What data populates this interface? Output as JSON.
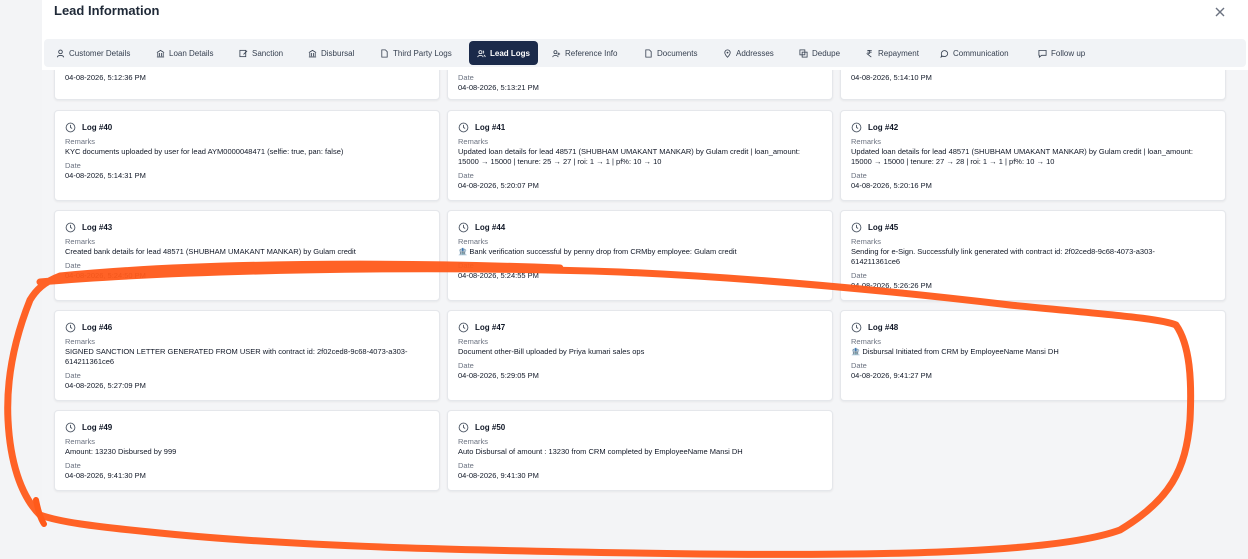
{
  "modal": {
    "title": "Lead Information",
    "close_icon": "close-icon"
  },
  "tabs": [
    {
      "label": "Customer Details",
      "icon": "user-icon"
    },
    {
      "label": "Loan Details",
      "icon": "bank-icon"
    },
    {
      "label": "Sanction",
      "icon": "edit-icon"
    },
    {
      "label": "Disbursal",
      "icon": "bank-icon"
    },
    {
      "label": "Third Party Logs",
      "icon": "file-icon"
    },
    {
      "label": "Lead Logs",
      "icon": "users-icon",
      "active": true
    },
    {
      "label": "Reference Info",
      "icon": "users-icon"
    },
    {
      "label": "Documents",
      "icon": "file-icon"
    },
    {
      "label": "Addresses",
      "icon": "pin-icon"
    },
    {
      "label": "Dedupe",
      "icon": "copy-icon"
    },
    {
      "label": "Repayment",
      "icon": "rupee-icon"
    },
    {
      "label": "Communication",
      "icon": "chat-icon"
    },
    {
      "label": "Follow up",
      "icon": "chat-icon"
    }
  ],
  "partial_top": [
    {
      "date": "04-08-2026, 5:12:36 PM"
    },
    {
      "date_label": "Date",
      "date": "04-08-2026, 5:13:21 PM"
    },
    {
      "date": "04-08-2026, 5:14:10 PM"
    }
  ],
  "labels": {
    "remarks": "Remarks",
    "date": "Date"
  },
  "logs": [
    {
      "title": "Log #40",
      "remarks": [
        "KYC documents uploaded by user for lead AYM0000048471 (selfie: true, pan: false)"
      ],
      "date": "04-08-2026, 5:14:31 PM"
    },
    {
      "title": "Log #41",
      "remarks": [
        "Updated loan details for lead 48571 (SHUBHAM UMAKANT MANKAR) by Gulam credit | loan_amount:",
        "15000 → 15000 | tenure: 25 → 27 | roi: 1 → 1 | pf%: 10 → 10"
      ],
      "date": "04-08-2026, 5:20:07 PM"
    },
    {
      "title": "Log #42",
      "remarks": [
        "Updated loan details for lead 48571 (SHUBHAM UMAKANT MANKAR) by Gulam credit | loan_amount:",
        "15000 → 15000 | tenure: 27 → 28 | roi: 1 → 1 | pf%: 10 → 10"
      ],
      "date": "04-08-2026, 5:20:16 PM"
    },
    {
      "title": "Log #43",
      "remarks": [
        "Created bank details for lead 48571 (SHUBHAM UMAKANT MANKAR) by Gulam credit"
      ],
      "date": "04-08-2026, 5:24:50 PM"
    },
    {
      "title": "Log #44",
      "remarks": [
        "🏦 Bank verification successful by penny drop from CRMby employee: Gulam credit"
      ],
      "date": "04-08-2026, 5:24:55 PM"
    },
    {
      "title": "Log #45",
      "remarks": [
        "Sending for e-Sign. Successfully link generated with contract id: 2f02ced8-9c68-4073-a303-",
        "614211361ce6"
      ],
      "date": "04-08-2026, 5:26:26 PM"
    },
    {
      "title": "Log #46",
      "remarks": [
        "SIGNED SANCTION LETTER GENERATED FROM USER with contract id: 2f02ced8-9c68-4073-a303-",
        "614211361ce6"
      ],
      "date": "04-08-2026, 5:27:09 PM"
    },
    {
      "title": "Log #47",
      "remarks": [
        "Document other-Bill uploaded by Priya kumari sales ops"
      ],
      "date": "04-08-2026, 5:29:05 PM"
    },
    {
      "title": "Log #48",
      "remarks": [
        "🏦 Disbursal Initiated from CRM by EmployeeName Mansi DH"
      ],
      "date": "04-08-2026, 9:41:27 PM"
    },
    {
      "title": "Log #49",
      "remarks": [
        "Amount: 13230 Disbursed by 999"
      ],
      "date": "04-08-2026, 9:41:30 PM"
    },
    {
      "title": "Log #50",
      "remarks": [
        "Auto Disbursal of amount : 13230 from CRM completed by EmployeeName Mansi DH"
      ],
      "date": "04-08-2026, 9:41:30 PM"
    }
  ],
  "annotation": {
    "color": "#ff5a1a"
  }
}
